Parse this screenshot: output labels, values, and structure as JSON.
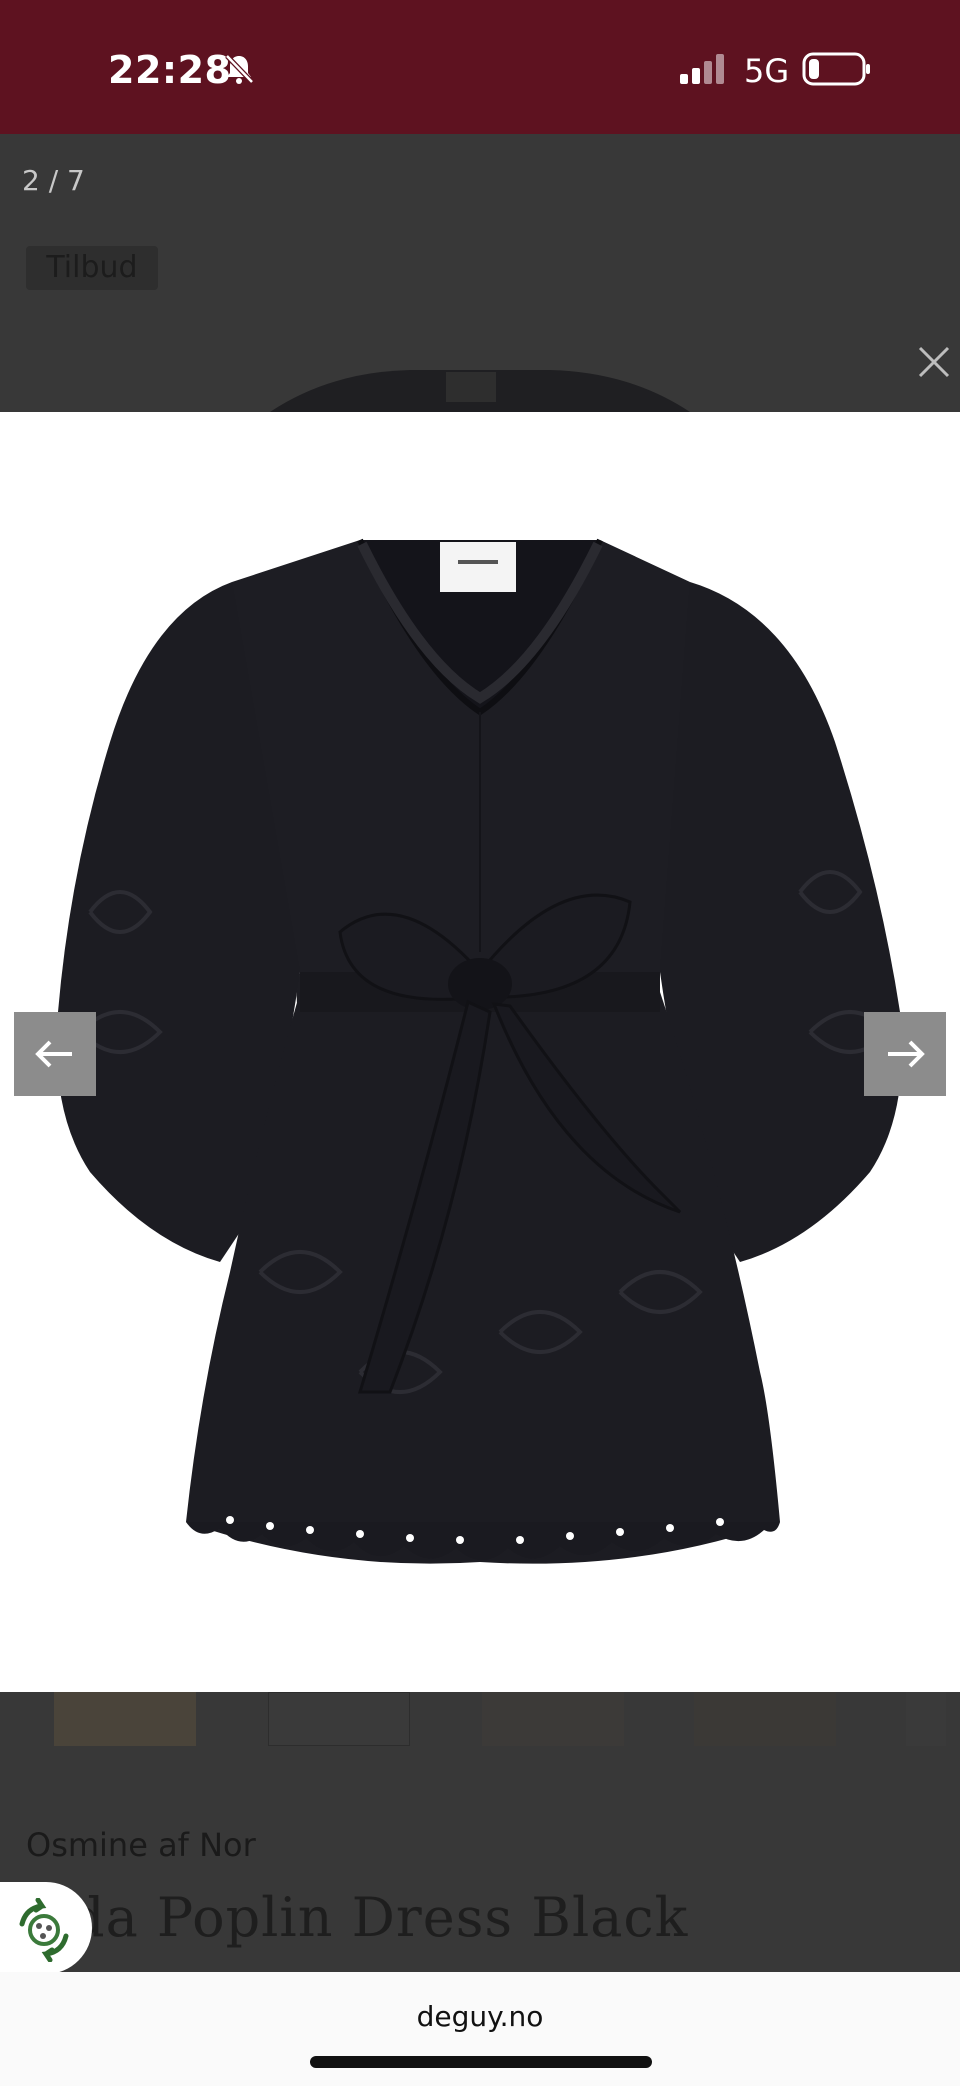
{
  "status_bar": {
    "time": "22:28",
    "network": "5G",
    "icons": [
      "bell-muted-icon",
      "signal-icon",
      "battery-icon"
    ],
    "background": "#5e1220"
  },
  "gallery": {
    "counter": "2 / 7",
    "sale_badge": "Tilbud",
    "close_icon": "close-icon",
    "prev_icon": "arrow-left-icon",
    "next_icon": "arrow-right-icon",
    "image_alt": "Black poplin dress with bow belt and embroidered puff sleeves",
    "thumbnail_count": 5
  },
  "product": {
    "brand": "Osmine af Nor",
    "title": "da Poplin Dress Black"
  },
  "browser": {
    "url": "deguy.no"
  },
  "colors": {
    "accent": "#5e1220",
    "overlay": "#363636",
    "dress": "#1b1b20"
  }
}
